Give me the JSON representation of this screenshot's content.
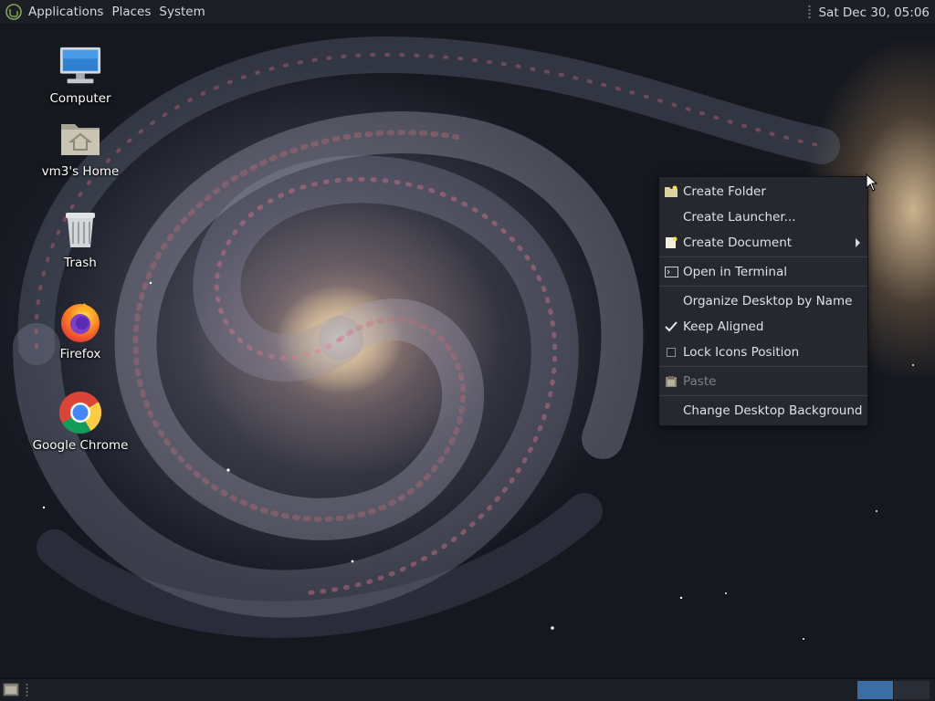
{
  "top_panel": {
    "menus": [
      "Applications",
      "Places",
      "System"
    ],
    "clock": "Sat Dec 30, 05:06"
  },
  "desktop_icons": [
    {
      "label": "Computer",
      "icon": "computer-icon"
    },
    {
      "label": "vm3's Home",
      "icon": "home-folder-icon"
    },
    {
      "label": "Trash",
      "icon": "trash-icon"
    },
    {
      "label": "Firefox",
      "icon": "firefox-icon"
    },
    {
      "label": "Google Chrome",
      "icon": "chrome-icon"
    }
  ],
  "context_menu": {
    "items": [
      {
        "label": "Create Folder",
        "icon": "folder-new-icon"
      },
      {
        "label": "Create Launcher...",
        "icon": ""
      },
      {
        "label": "Create Document",
        "icon": "document-new-icon",
        "submenu": true
      },
      {
        "label": "Open in Terminal",
        "icon": "terminal-icon"
      },
      {
        "label": "Organize Desktop by Name",
        "icon": ""
      },
      {
        "label": "Keep Aligned",
        "icon": "checkmark-icon",
        "checked": true
      },
      {
        "label": "Lock Icons Position",
        "icon": "checkbox-icon",
        "checked": false
      },
      {
        "label": "Paste",
        "icon": "paste-icon",
        "disabled": true
      },
      {
        "label": "Change Desktop Background",
        "icon": ""
      }
    ]
  },
  "bottom_panel": {
    "workspaces": 2,
    "active_workspace": 1
  },
  "colors": {
    "panel_bg": "#1b1e24",
    "menu_bg": "#25282f",
    "accent": "#3a6ea5"
  }
}
